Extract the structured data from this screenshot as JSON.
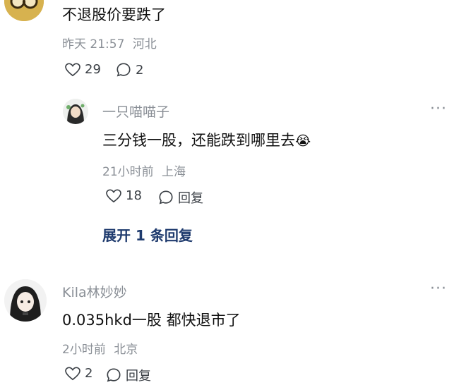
{
  "comment1": {
    "text": "不退股价要跌了",
    "time": "昨天 21:57",
    "location": "河北",
    "likes": "29",
    "replies": "2"
  },
  "reply1": {
    "username": "一只喵喵子",
    "text": "三分钱一股，还能跌到哪里去",
    "emoji": "😭",
    "time": "21小时前",
    "location": "上海",
    "likes": "18",
    "reply_label": "回复",
    "more_label": "···"
  },
  "expand_label": "展开 1 条回复",
  "comment2": {
    "username": "Kila林妙妙",
    "text": "0.035hkd一股 都快退市了",
    "time": "2小时前",
    "location": "北京",
    "likes": "2",
    "reply_label": "回复",
    "more_label": "···"
  }
}
